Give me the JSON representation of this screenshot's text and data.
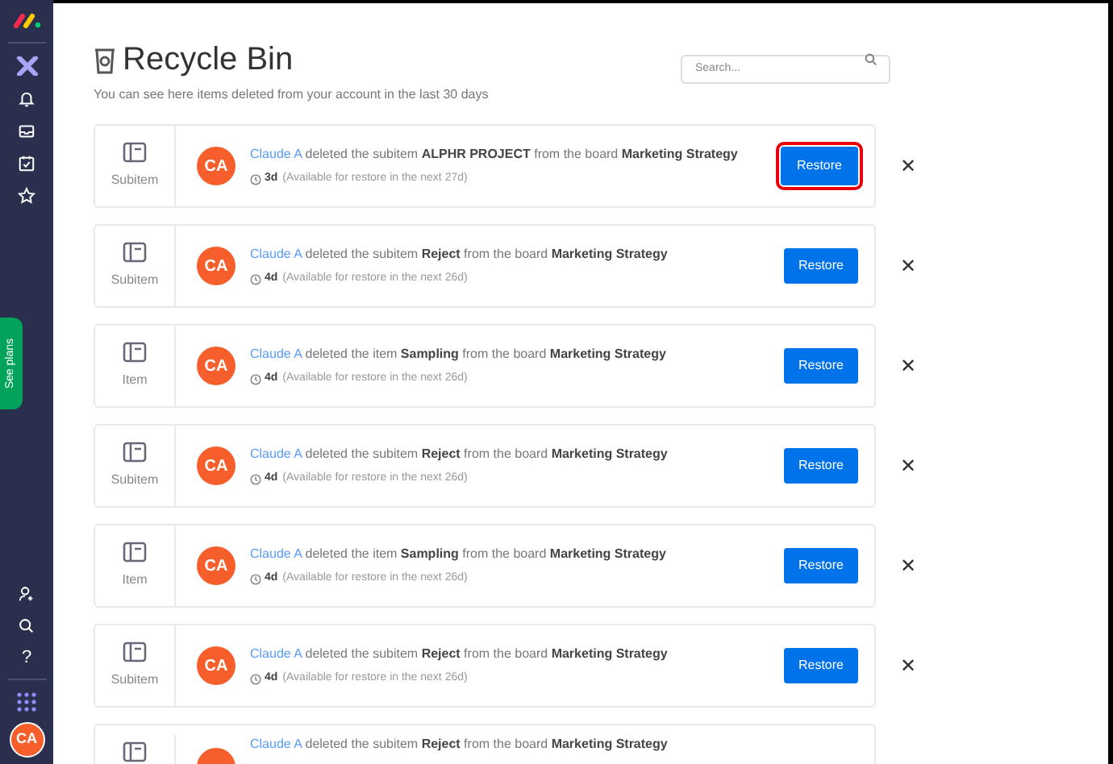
{
  "sidebar": {
    "see_plans": "See plans",
    "help": "?",
    "avatar": "CA"
  },
  "header": {
    "title": "Recycle Bin",
    "subtitle": "You can see here items deleted from your account in the last 30 days",
    "search": {
      "placeholder": "Search..."
    }
  },
  "items": [
    {
      "type": "Subitem",
      "avatar": "CA",
      "actor": "Claude A",
      "action": "deleted the subitem",
      "name": "ALPHR PROJECT",
      "connector": "from the board",
      "board": "Marketing Strategy",
      "age": "3d",
      "note": "(Available for restore in the next 27d)",
      "button": "Restore",
      "highlighted": true,
      "close": "✕"
    },
    {
      "type": "Subitem",
      "avatar": "CA",
      "actor": "Claude A",
      "action": "deleted the subitem",
      "name": "Reject",
      "connector": "from the board",
      "board": "Marketing Strategy",
      "age": "4d",
      "note": "(Available for restore in the next 26d)",
      "button": "Restore",
      "highlighted": false,
      "close": "✕"
    },
    {
      "type": "Item",
      "avatar": "CA",
      "actor": "Claude A",
      "action": "deleted the item",
      "name": "Sampling",
      "connector": "from the board",
      "board": "Marketing Strategy",
      "age": "4d",
      "note": "(Available for restore in the next 26d)",
      "button": "Restore",
      "highlighted": false,
      "close": "✕"
    },
    {
      "type": "Subitem",
      "avatar": "CA",
      "actor": "Claude A",
      "action": "deleted the subitem",
      "name": "Reject",
      "connector": "from the board",
      "board": "Marketing Strategy",
      "age": "4d",
      "note": "(Available for restore in the next 26d)",
      "button": "Restore",
      "highlighted": false,
      "close": "✕"
    },
    {
      "type": "Item",
      "avatar": "CA",
      "actor": "Claude A",
      "action": "deleted the item",
      "name": "Sampling",
      "connector": "from the board",
      "board": "Marketing Strategy",
      "age": "4d",
      "note": "(Available for restore in the next 26d)",
      "button": "Restore",
      "highlighted": false,
      "close": "✕"
    },
    {
      "type": "Subitem",
      "avatar": "CA",
      "actor": "Claude A",
      "action": "deleted the subitem",
      "name": "Reject",
      "connector": "from the board",
      "board": "Marketing Strategy",
      "age": "4d",
      "note": "(Available for restore in the next 26d)",
      "button": "Restore",
      "highlighted": false,
      "close": "✕"
    },
    {
      "actor": "Claude A",
      "action": "deleted the subitem",
      "name": "Reject",
      "connector": "from the board",
      "board": "Marketing Strategy"
    }
  ]
}
